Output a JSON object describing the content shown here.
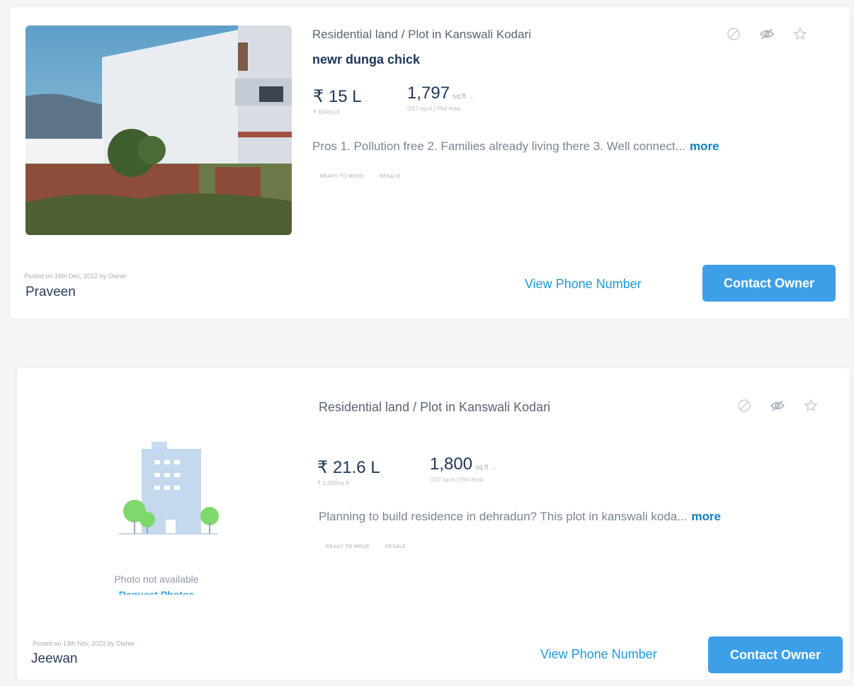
{
  "listings": [
    {
      "title_line": "Residential land / Plot in Kanswali Kodari",
      "subtitle": "newr dunga chick",
      "price": "₹ 15 L",
      "price_per_sqft": "₹ 834/sq.ft",
      "area_value": "1,797",
      "area_unit": "sq.ft",
      "area_sub": "(167 sq.m.) Plot Area",
      "description": "Pros 1. Pollution free 2. Families already living there 3. Well connect...",
      "more_label": "more",
      "tags": [
        "READY TO MOVE",
        "RESALE"
      ],
      "posted": "Posted on 16th Dec, 2022 by Owner",
      "owner": "Praveen",
      "view_phone_label": "View Phone Number",
      "contact_label": "Contact Owner"
    },
    {
      "title_line": "Residential land / Plot in Kanswali Kodari",
      "price": "₹ 21.6 L",
      "price_per_sqft": "₹ 1,200/sq.ft",
      "area_value": "1,800",
      "area_unit": "sq.ft",
      "area_sub": "(167 sq.m.) Plot Area",
      "description": "Planning to build residence in dehradun? This plot in kanswali koda...",
      "more_label": "more",
      "tags": [
        "READY TO MOVE",
        "RESALE"
      ],
      "no_photo_text": "Photo not available",
      "request_photos_label": "Request Photos",
      "posted": "Posted on 13th Nov, 2022 by Owner",
      "owner": "Jeewan",
      "view_phone_label": "View Phone Number",
      "contact_label": "Contact Owner"
    }
  ],
  "icons": [
    "block-icon",
    "hide-icon",
    "star-icon"
  ],
  "colors": {
    "accent_blue": "#3d9fe8",
    "link_blue": "#1b9ae0",
    "dark_text": "#1d3758",
    "muted_text": "#7a8595"
  }
}
